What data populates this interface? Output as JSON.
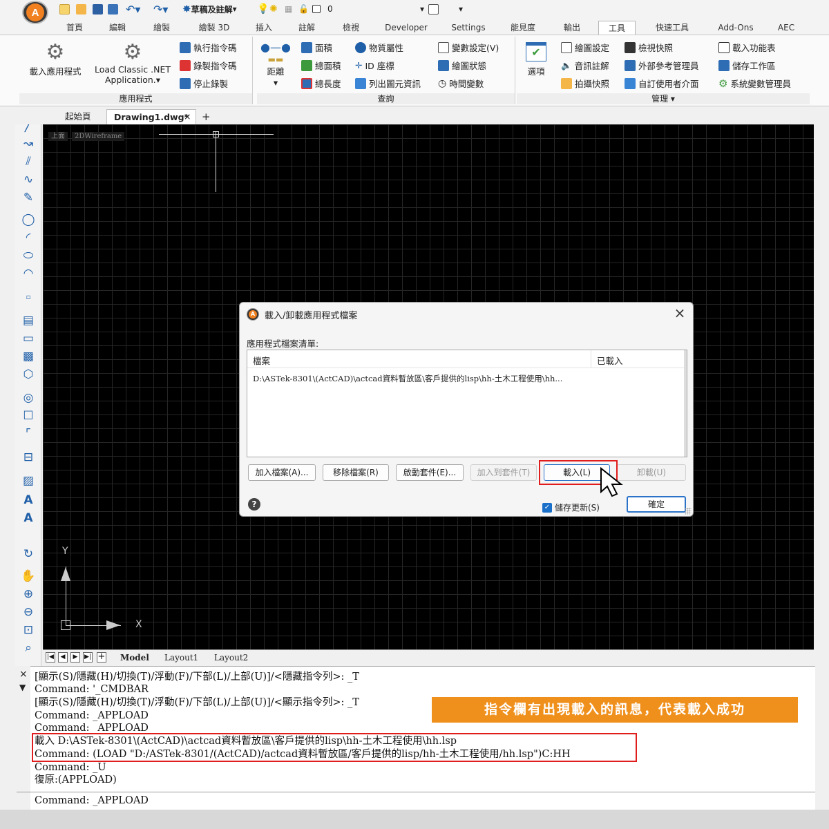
{
  "quick_access": {
    "sketch_annotate": "草稿及註解",
    "layer_value": "0"
  },
  "ribbon_tabs": [
    "首頁",
    "編輯",
    "繪製",
    "繪製 3D",
    "插入",
    "註解",
    "檢視",
    "Developer",
    "Settings",
    "能見度",
    "輸出",
    "工具",
    "快速工具",
    "Add-Ons",
    "AEC"
  ],
  "active_tab": "工具",
  "ribbon": {
    "app_group": {
      "load_app": "載入應用程式",
      "load_net_line1": "Load Classic .NET",
      "load_net_line2": "Application.▾",
      "run_script": "執行指令碼",
      "record_script": "錄製指令碼",
      "stop_record": "停止錄製",
      "label": "應用程式"
    },
    "query_group": {
      "distance": "距離",
      "area": "面積",
      "total_area": "總面積",
      "total_length": "總長度",
      "mass_props": "物質屬性",
      "id_point": "ID 座標",
      "list": "列出圖元資訊",
      "set_var": "變數設定(V)",
      "drawing_status": "繪圖狀態",
      "time": "時間變數",
      "label": "查詢"
    },
    "manage_group": {
      "options": "選項",
      "drawing_settings": "繪圖設定",
      "view_snapshot": "檢視快照",
      "load_toolbar": "載入功能表",
      "sound_notes": "音訊註解",
      "xref_manager": "外部參考管理員",
      "save_workspace": "儲存工作區",
      "take_snapshot": "拍攝快照",
      "customize_ui": "自訂使用者介面",
      "sysvar_manager": "系統變數管理員",
      "label": "管理 ▾"
    }
  },
  "doc_tabs": {
    "start": "起始頁",
    "drawing": "Drawing1.dwg*",
    "close": "×",
    "add": "+"
  },
  "viewport": {
    "view": "上面",
    "style": "2DWireframe"
  },
  "layout_tabs": [
    "Model",
    "Layout1",
    "Layout2"
  ],
  "axis": {
    "x": "X",
    "y": "Y"
  },
  "dialog": {
    "title": "載入/卸載應用程式檔案",
    "list_label": "應用程式檔案清單:",
    "col_file": "檔案",
    "col_loaded": "已載入",
    "file_entry": "D:\\ASTek-8301\\(ActCAD)\\actcad資料暫放區\\客戶提供的lisp\\hh-土木工程使用\\hh...",
    "btn_add": "加入檔案(A)...",
    "btn_remove": "移除檔案(R)",
    "btn_startup": "啟動套件(E)...",
    "btn_add_suite": "加入到套件(T)",
    "btn_load": "載入(L)",
    "btn_unload": "卸載(U)",
    "save_updates": "儲存更新(S)",
    "btn_ok": "確定"
  },
  "command_history": [
    "[顯示(S)/隱藏(H)/切換(T)/浮動(F)/下部(L)/上部(U)]/<隱藏指令列>: _T",
    "Command: '_CMDBAR",
    "[顯示(S)/隱藏(H)/切換(T)/浮動(F)/下部(L)/上部(U)]/<顯示指令列>: _T",
    "Command: _APPLOAD",
    "Command: _APPLOAD",
    "載入 D:\\ASTek-8301\\(ActCAD)\\actcad資料暫放區\\客戶提供的lisp\\hh-土木工程使用\\hh.lsp",
    "Command: (LOAD \"D:/ASTek-8301/(ActCAD)/actcad資料暫放區/客戶提供的lisp/hh-土木工程使用/hh.lsp\")C:HH",
    "Command: _U",
    "復原:(APPLOAD)"
  ],
  "command_prompt": "Command: _APPLOAD",
  "callout": "指令欄有出現載入的訊息，代表載入成功",
  "colors": {
    "accent": "#f0901c",
    "highlight": "#e01c1c",
    "canvas": "#000000"
  }
}
